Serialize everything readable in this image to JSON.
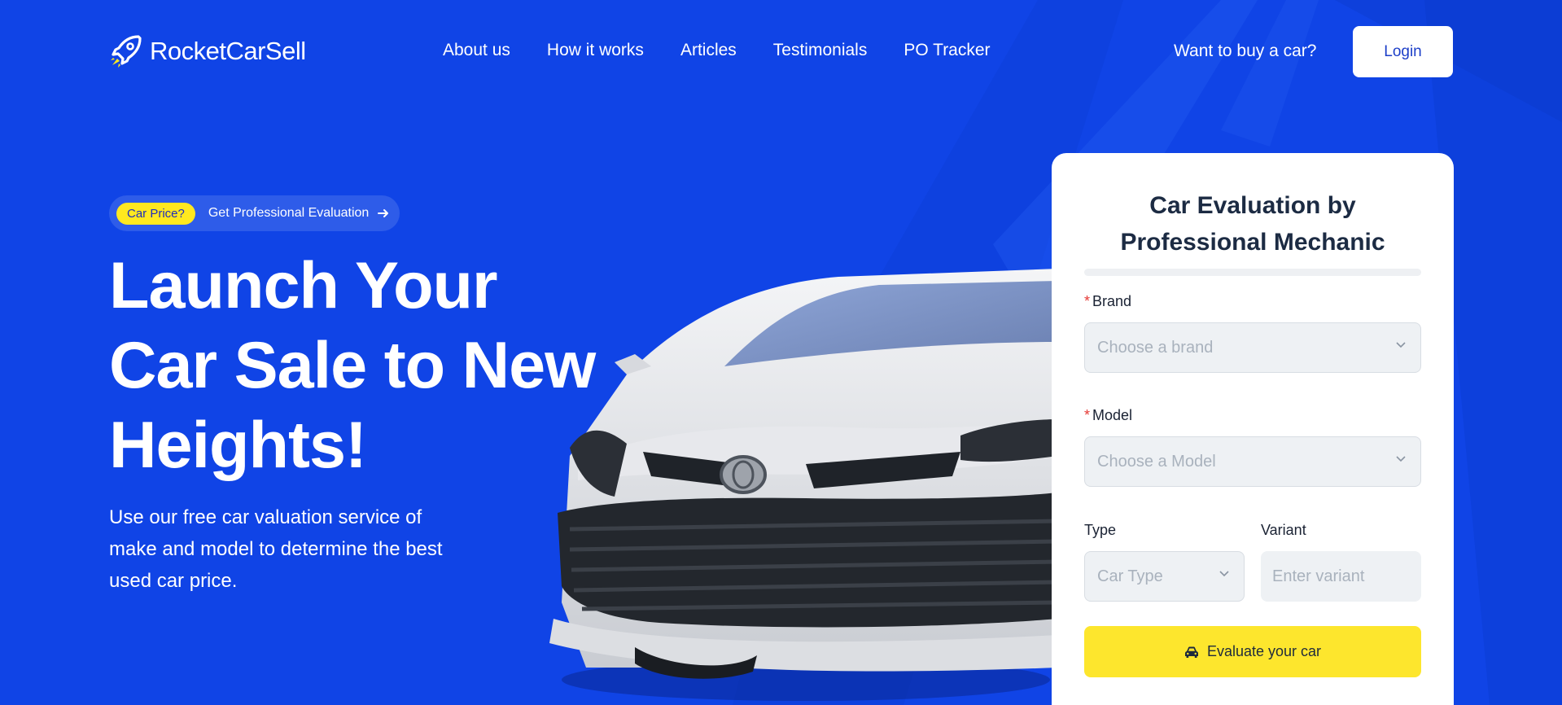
{
  "header": {
    "logo_text": "RocketCarSell",
    "logo_icon": "rocket-icon",
    "nav": [
      "About us",
      "How it works",
      "Articles",
      "Testimonials",
      "PO Tracker"
    ],
    "buy_link": "Want to buy a car?",
    "login_label": "Login"
  },
  "hero": {
    "badge_pill": "Car Price?",
    "badge_text": "Get Professional Evaluation",
    "badge_icon": "arrow-right-icon",
    "headline_lines": [
      "Launch Your",
      "Car Sale to New",
      "Heights!"
    ],
    "subtext": "Use our free car valuation service of make and model to determine the best used car price."
  },
  "form": {
    "title_lines": [
      "Car Evaluation by",
      "Professional Mechanic"
    ],
    "brand": {
      "label": "Brand",
      "required_mark": "*",
      "placeholder": "Choose a brand"
    },
    "model": {
      "label": "Model",
      "required_mark": "*",
      "placeholder": "Choose a Model"
    },
    "type": {
      "label": "Type",
      "placeholder": "Car Type"
    },
    "variant": {
      "label": "Variant",
      "placeholder": "Enter variant"
    },
    "submit_label": "Evaluate your car",
    "submit_icon": "car-icon"
  },
  "colors": {
    "background": "#1044e6",
    "accent_yellow": "#fde62d",
    "login_text": "#1d3fc8",
    "required": "#e53935"
  }
}
